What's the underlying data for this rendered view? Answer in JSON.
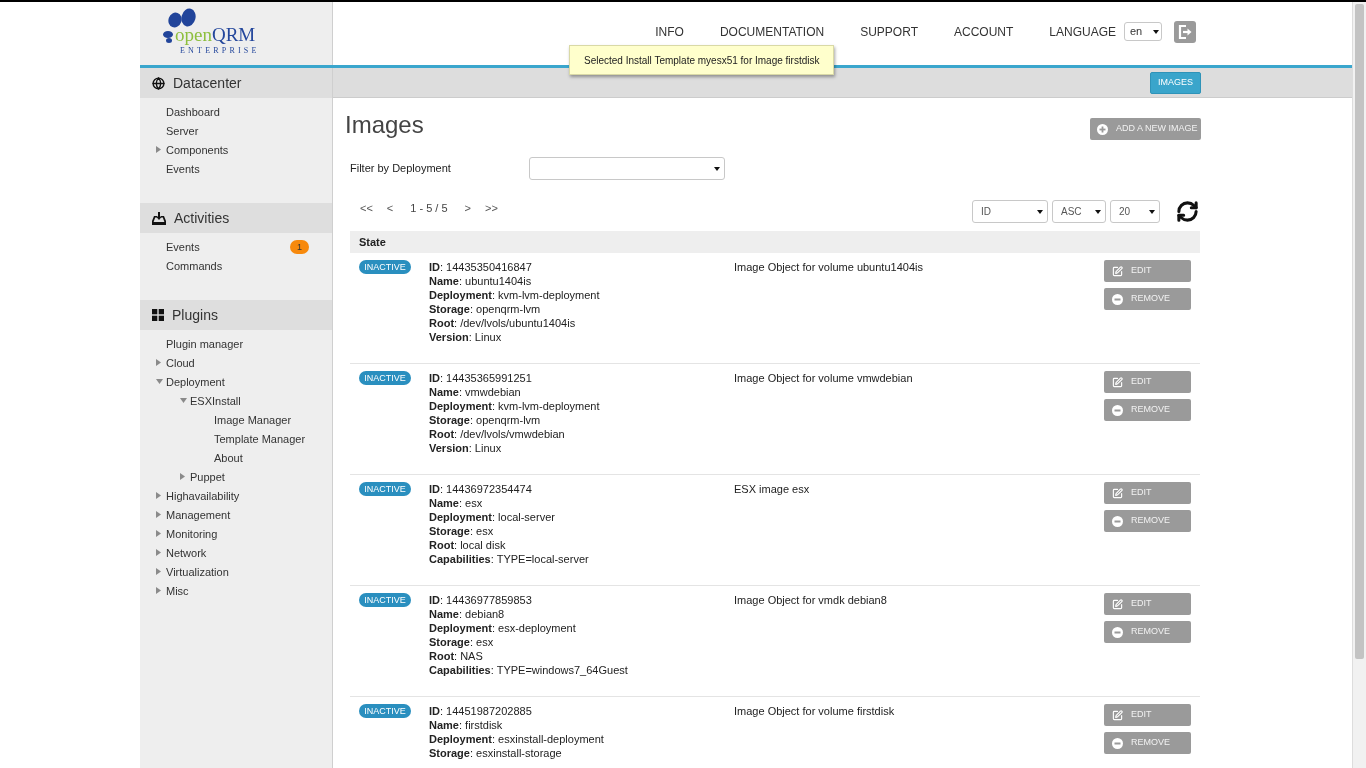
{
  "logo": {
    "name_parts": [
      "open",
      "QRM"
    ],
    "tagline": "ENTERPRISE"
  },
  "top_nav": {
    "links": [
      "INFO",
      "DOCUMENTATION",
      "SUPPORT",
      "ACCOUNT"
    ],
    "language_label": "LANGUAGE",
    "language_value": "en"
  },
  "notification": "Selected Install Template myesx51 for Image firstdisk",
  "sidebar": {
    "sections": [
      {
        "title": "Datacenter",
        "items": [
          {
            "label": "Dashboard"
          },
          {
            "label": "Server"
          },
          {
            "label": "Components",
            "expanded": false
          },
          {
            "label": "Events"
          }
        ]
      },
      {
        "title": "Activities",
        "items": [
          {
            "label": "Events",
            "badge": "1"
          },
          {
            "label": "Commands"
          }
        ]
      },
      {
        "title": "Plugins",
        "items": [
          {
            "label": "Plugin manager"
          },
          {
            "label": "Cloud",
            "expanded": false
          },
          {
            "label": "Deployment",
            "expanded": true,
            "children": [
              {
                "label": "ESXInstall",
                "expanded": true,
                "children": [
                  {
                    "label": "Image Manager"
                  },
                  {
                    "label": "Template Manager"
                  },
                  {
                    "label": "About"
                  }
                ]
              },
              {
                "label": "Puppet",
                "expanded": false
              }
            ]
          },
          {
            "label": "Highavailability",
            "expanded": false
          },
          {
            "label": "Management",
            "expanded": false
          },
          {
            "label": "Monitoring",
            "expanded": false
          },
          {
            "label": "Network",
            "expanded": false
          },
          {
            "label": "Virtualization",
            "expanded": false
          },
          {
            "label": "Misc",
            "expanded": false
          }
        ]
      }
    ]
  },
  "tabs": [
    {
      "label": "IMAGES",
      "selected": true
    }
  ],
  "page": {
    "title": "Images",
    "add_button": "ADD A NEW IMAGE",
    "filter": {
      "label": "Filter by Deployment"
    },
    "pagination": {
      "first": "<<",
      "previous": "<",
      "range": "1 - 5 / 5",
      "next": ">",
      "last": ">>"
    },
    "sort": {
      "field": "ID",
      "order": "ASC",
      "per_page": "20"
    }
  },
  "table": {
    "columns": [
      "State"
    ],
    "rows": [
      {
        "state": "INACTIVE",
        "details": [
          "**ID**: 14435350416847",
          "**Name**: ubuntu1404is",
          "**Deployment**: kvm-lvm-deployment",
          "**Storage**: openqrm-lvm",
          "**Root**: /dev/lvols/ubuntu1404is",
          "**Version**: Linux"
        ],
        "description": "Image Object for volume ubuntu1404is",
        "actions": [
          {
            "kind": "edit",
            "label": "EDIT"
          },
          {
            "kind": "remove",
            "label": "REMOVE"
          }
        ]
      },
      {
        "state": "INACTIVE",
        "details": [
          "**ID**: 14435365991251",
          "**Name**: vmwdebian",
          "**Deployment**: kvm-lvm-deployment",
          "**Storage**: openqrm-lvm",
          "**Root**: /dev/lvols/vmwdebian",
          "**Version**: Linux"
        ],
        "description": "Image Object for volume vmwdebian",
        "actions": [
          {
            "kind": "edit",
            "label": "EDIT"
          },
          {
            "kind": "remove",
            "label": "REMOVE"
          }
        ]
      },
      {
        "state": "INACTIVE",
        "details": [
          "**ID**: 14436972354474",
          "**Name**: esx",
          "**Deployment**: local-server",
          "**Storage**: esx",
          "**Root**: local disk",
          "**Capabilities**: TYPE=local-server"
        ],
        "description": "ESX image esx",
        "actions": [
          {
            "kind": "edit",
            "label": "EDIT"
          },
          {
            "kind": "remove",
            "label": "REMOVE"
          }
        ]
      },
      {
        "state": "INACTIVE",
        "details": [
          "**ID**: 14436977859853",
          "**Name**: debian8",
          "**Deployment**: esx-deployment",
          "**Storage**: esx",
          "**Root**: NAS",
          "**Capabilities**: TYPE=windows7_64Guest"
        ],
        "description": "Image Object for vmdk debian8",
        "actions": [
          {
            "kind": "edit",
            "label": "EDIT"
          },
          {
            "kind": "remove",
            "label": "REMOVE"
          }
        ]
      },
      {
        "state": "INACTIVE",
        "details": [
          "**ID**: 14451987202885",
          "**Name**: firstdisk",
          "**Deployment**: esxinstall-deployment",
          "**Storage**: esxinstall-storage"
        ],
        "description": "Image Object for volume firstdisk",
        "actions": [
          {
            "kind": "edit",
            "label": "EDIT"
          },
          {
            "kind": "remove",
            "label": "REMOVE"
          }
        ]
      }
    ]
  }
}
